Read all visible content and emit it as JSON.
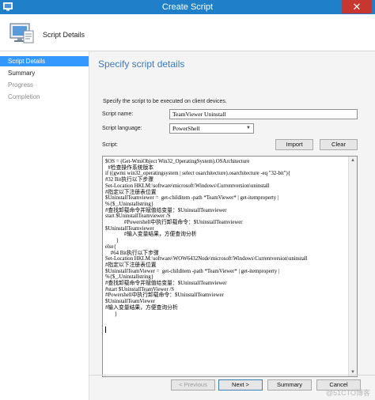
{
  "window": {
    "title": "Create Script",
    "close_glyph": "✕"
  },
  "header": {
    "title": "Script Details",
    "icon": "computer-script-icon"
  },
  "nav": {
    "items": [
      {
        "label": "Script Details",
        "state": "active"
      },
      {
        "label": "Summary",
        "state": "normal"
      },
      {
        "label": "Progress",
        "state": "dim"
      },
      {
        "label": "Completion",
        "state": "dim"
      }
    ]
  },
  "main": {
    "heading": "Specify script details",
    "description": "Specify the script to be executed on client devices.",
    "script_name_label": "Script name:",
    "script_name_value": "TeamViewer Uninstall",
    "script_language_label": "Script language:",
    "script_language_value": "PowerShell",
    "script_label": "Script:",
    "import_label": "Import",
    "clear_label": "Clear",
    "script_text": "$OS = (Get-WmiObject Win32_OperatingSystem).OSArchitecture\n  #检查操作系统版本\nif ((gwmi win32_operatingsystem | select osarchitecture).osarchitecture -eq \"32-bit\"){\n#32 Bit执行以下步骤\nSet-Location HKLM:\\software\\microsoft\\Windows\\Currentversion\\uninstall\n#指定以下注册表位置\n$UninstallTeamviewer =  get-childitem -path *TeamViewer* | get-itemproperty |\n%{$_.Uninstallstring}\n#查找卸载命令并赋值给变量：$UninstallTeamviewer\nstart $UninstallTeamviewer /S\n              #Powershell中执行卸载命令：$UninstallTeamviewer\n$UninstallTeamviewer\n              #输入变量结果，方便查询分析\n        }\nelse{\n    #64 Bit执行以下步骤\nSet-Location HKLM:\\software\\WOW6432Node\\microsoft\\Windows\\Currentversion\\uninstall\n#指定以下注册表位置\n$UninstallTeamViewer =  get-childitem -path *TeamViewer* | get-itemproperty |\n%{$_.Uninstallstring}\n#查找卸载命令并赋值给变量：$UninstallTeamviewer\n#start $UninstallTeamViewer /S\n#Powershell中执行卸载命令：$UninstallTeamviewer\n$UninstallTeamViewer\n#输入变量结果，方便查询分析\n       }"
  },
  "footer": {
    "previous_label": "< Previous",
    "next_label": "Next >",
    "summary_label": "Summary",
    "cancel_label": "Cancel"
  },
  "watermark": "@51CTO博客",
  "colors": {
    "titlebar": "#1f7fc9",
    "nav_active": "#3399ff",
    "heading": "#3d7ab8",
    "close": "#c7372f"
  }
}
